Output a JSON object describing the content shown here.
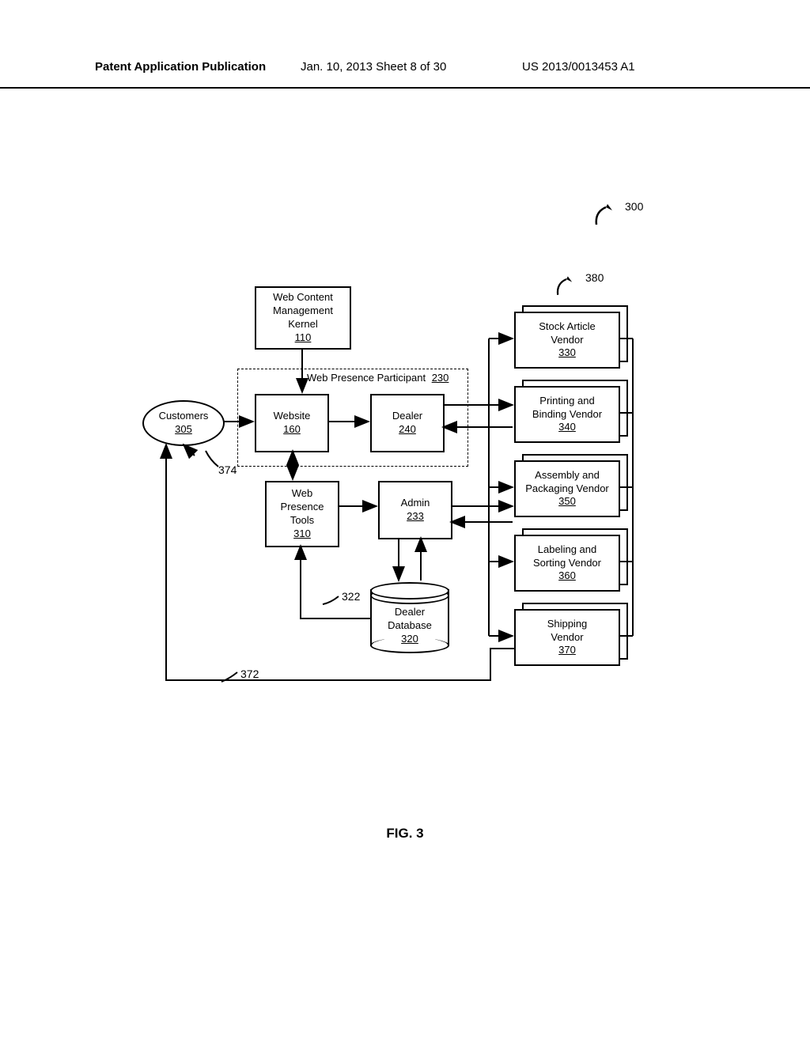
{
  "header": {
    "left": "Patent Application Publication",
    "center": "Jan. 10, 2013  Sheet 8 of 30",
    "right": "US 2013/0013453 A1"
  },
  "figure_label": "FIG. 3",
  "refs": {
    "r300": "300",
    "r380": "380",
    "r374": "374",
    "r372": "372",
    "r322": "322"
  },
  "boxes": {
    "wcmk": {
      "lines": [
        "Web Content",
        "Management",
        "Kernel"
      ],
      "num": "110"
    },
    "wpp": {
      "label_text": "Web Presence Participant",
      "label_num": "230"
    },
    "website": {
      "lines": [
        "Website"
      ],
      "num": "160"
    },
    "dealer": {
      "lines": [
        "Dealer"
      ],
      "num": "240"
    },
    "wpt": {
      "lines": [
        "Web",
        "Presence",
        "Tools"
      ],
      "num": "310"
    },
    "admin": {
      "lines": [
        "Admin"
      ],
      "num": "233"
    },
    "dealerdb": {
      "lines": [
        "Dealer",
        "Database"
      ],
      "num": "320"
    },
    "customers": {
      "lines": [
        "Customers"
      ],
      "num": "305"
    },
    "v330": {
      "lines": [
        "Stock Article",
        "Vendor"
      ],
      "num": "330"
    },
    "v340": {
      "lines": [
        "Printing and",
        "Binding Vendor"
      ],
      "num": "340"
    },
    "v350": {
      "lines": [
        "Assembly and",
        "Packaging Vendor"
      ],
      "num": "350"
    },
    "v360": {
      "lines": [
        "Labeling and",
        "Sorting Vendor"
      ],
      "num": "360"
    },
    "v370": {
      "lines": [
        "Shipping",
        "Vendor"
      ],
      "num": "370"
    }
  }
}
